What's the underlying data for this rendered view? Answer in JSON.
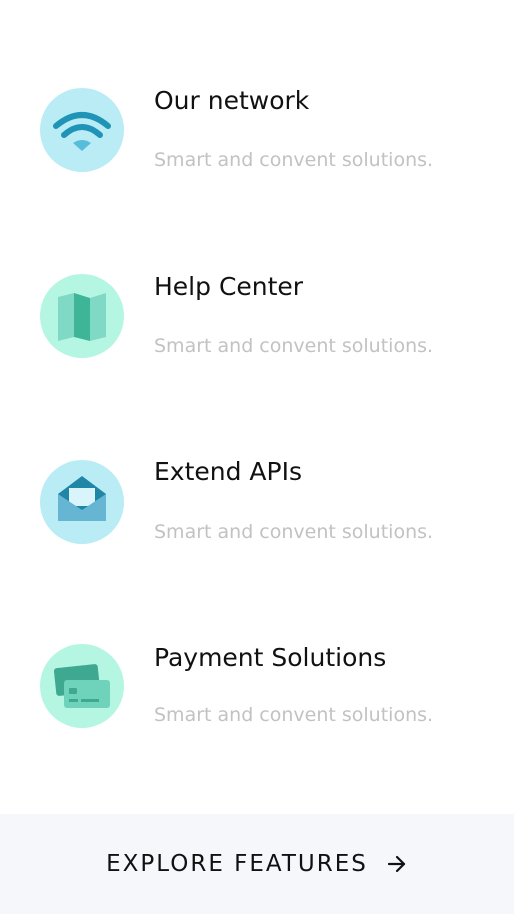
{
  "features": [
    {
      "title": "Our network",
      "description": "Smart and convent solutions.",
      "icon": "wifi-icon",
      "circle_color": "#b9ecf5"
    },
    {
      "title": "Help Center",
      "description": "Smart and convent solutions.",
      "icon": "map-icon",
      "circle_color": "#b5f6e3"
    },
    {
      "title": "Extend APIs",
      "description": "Smart and convent solutions.",
      "icon": "envelope-icon",
      "circle_color": "#b9ecf5"
    },
    {
      "title": "Payment Solutions",
      "description": "Smart and convent solutions.",
      "icon": "credit-card-icon",
      "circle_color": "#b5f6e3"
    }
  ],
  "explore": {
    "label": "EXPLORE FEATURES",
    "icon": "arrow-right-icon",
    "background": "#f6f7fb"
  }
}
